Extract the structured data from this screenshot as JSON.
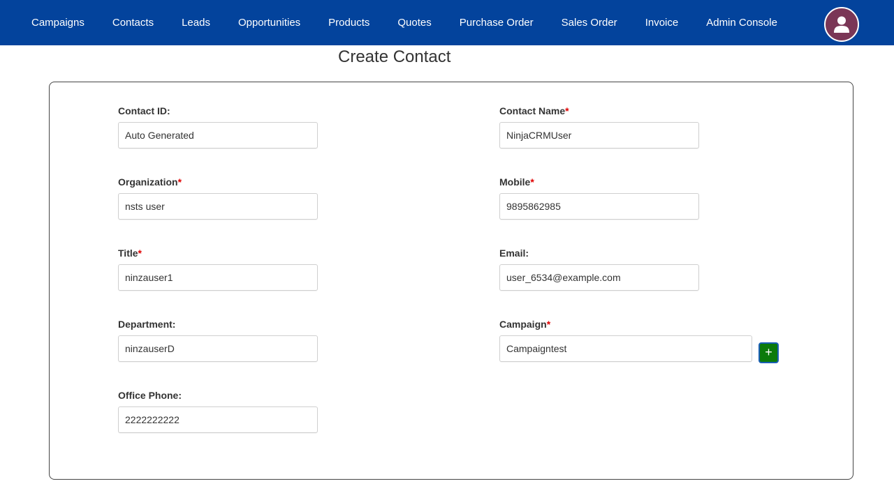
{
  "nav": {
    "items": [
      {
        "label": "Campaigns"
      },
      {
        "label": "Contacts"
      },
      {
        "label": "Leads"
      },
      {
        "label": "Opportunities"
      },
      {
        "label": "Products"
      },
      {
        "label": "Quotes"
      },
      {
        "label": "Purchase Order"
      },
      {
        "label": "Sales Order"
      },
      {
        "label": "Invoice"
      },
      {
        "label": "Admin Console"
      }
    ],
    "avatar_icon": "user-icon"
  },
  "page": {
    "title": "Create Contact"
  },
  "form": {
    "contact_id": {
      "label": "Contact ID:",
      "value": "Auto Generated",
      "required": false
    },
    "contact_name": {
      "label": "Contact Name",
      "value": "NinjaCRMUser",
      "required": true
    },
    "organization": {
      "label": "Organization",
      "value": "nsts user",
      "required": true
    },
    "mobile": {
      "label": "Mobile",
      "value": "9895862985",
      "required": true
    },
    "title": {
      "label": "Title",
      "value": "ninzauser1",
      "required": true
    },
    "email": {
      "label": "Email:",
      "value": "user_6534@example.com",
      "required": false
    },
    "department": {
      "label": "Department:",
      "value": "ninzauserD",
      "required": false
    },
    "campaign": {
      "label": "Campaign",
      "value": "Campaigntest",
      "required": true,
      "add_label": "+"
    },
    "office_phone": {
      "label": "Office Phone:",
      "value": "2222222222",
      "required": false
    },
    "required_marker": "*"
  },
  "colors": {
    "navbar": "#03439c",
    "avatar": "#7a3656",
    "required": "#e00000",
    "add_button": "#0b7a0b"
  }
}
